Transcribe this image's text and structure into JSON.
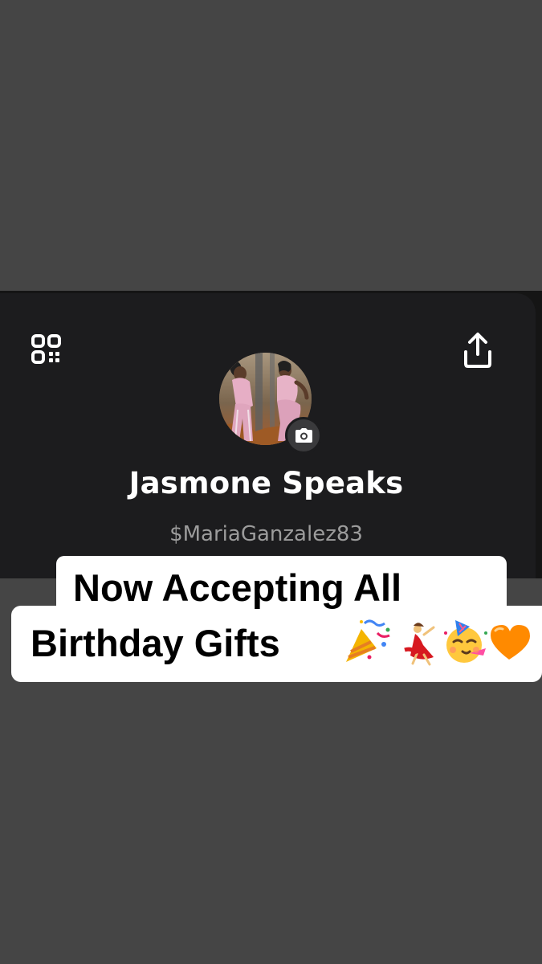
{
  "profile": {
    "display_name": "Jasmone Speaks",
    "cashtag": "$MariaGanzalez83",
    "avatar": "profile-photo",
    "qr_icon": "qr-code-icon",
    "share_icon": "share-upload-icon",
    "camera_icon": "camera-icon"
  },
  "caption": {
    "line1": "Now Accepting All",
    "line2": "Birthday Gifts",
    "emojis": [
      "party-popper-emoji",
      "dancing-woman-emoji",
      "partying-face-emoji",
      "orange-heart-emoji"
    ]
  },
  "colors": {
    "background": "#454545",
    "card": "#1c1c1e",
    "text_primary": "#ffffff",
    "text_secondary": "#9c9c9c",
    "caption_bg": "#ffffff"
  }
}
